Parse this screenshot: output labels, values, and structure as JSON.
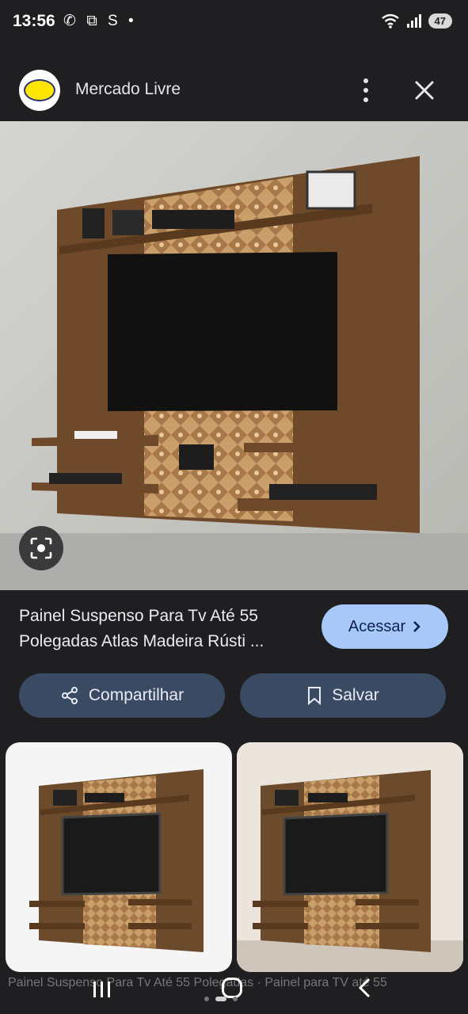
{
  "status_bar": {
    "time": "13:56",
    "left_icons": "✆ ⧉ S •",
    "battery": "47"
  },
  "header": {
    "source_name": "Mercado Livre",
    "more_icon": "more-vert-icon",
    "close_icon": "close-icon"
  },
  "result": {
    "title_line1": "Painel Suspenso Para Tv Até 55",
    "title_line2": "Polegadas Atlas Madeira Rústi ...",
    "visit_label": "Acessar",
    "share_label": "Compartilhar",
    "save_label": "Salvar"
  },
  "footer": {
    "faded_text": "Painel Suspenso Para Tv Até 55 Polegadas · Painel para TV até 55"
  },
  "colors": {
    "background": "#1f1f22",
    "accent_button": "#a8c8fa",
    "secondary_button": "#3b4a63"
  }
}
